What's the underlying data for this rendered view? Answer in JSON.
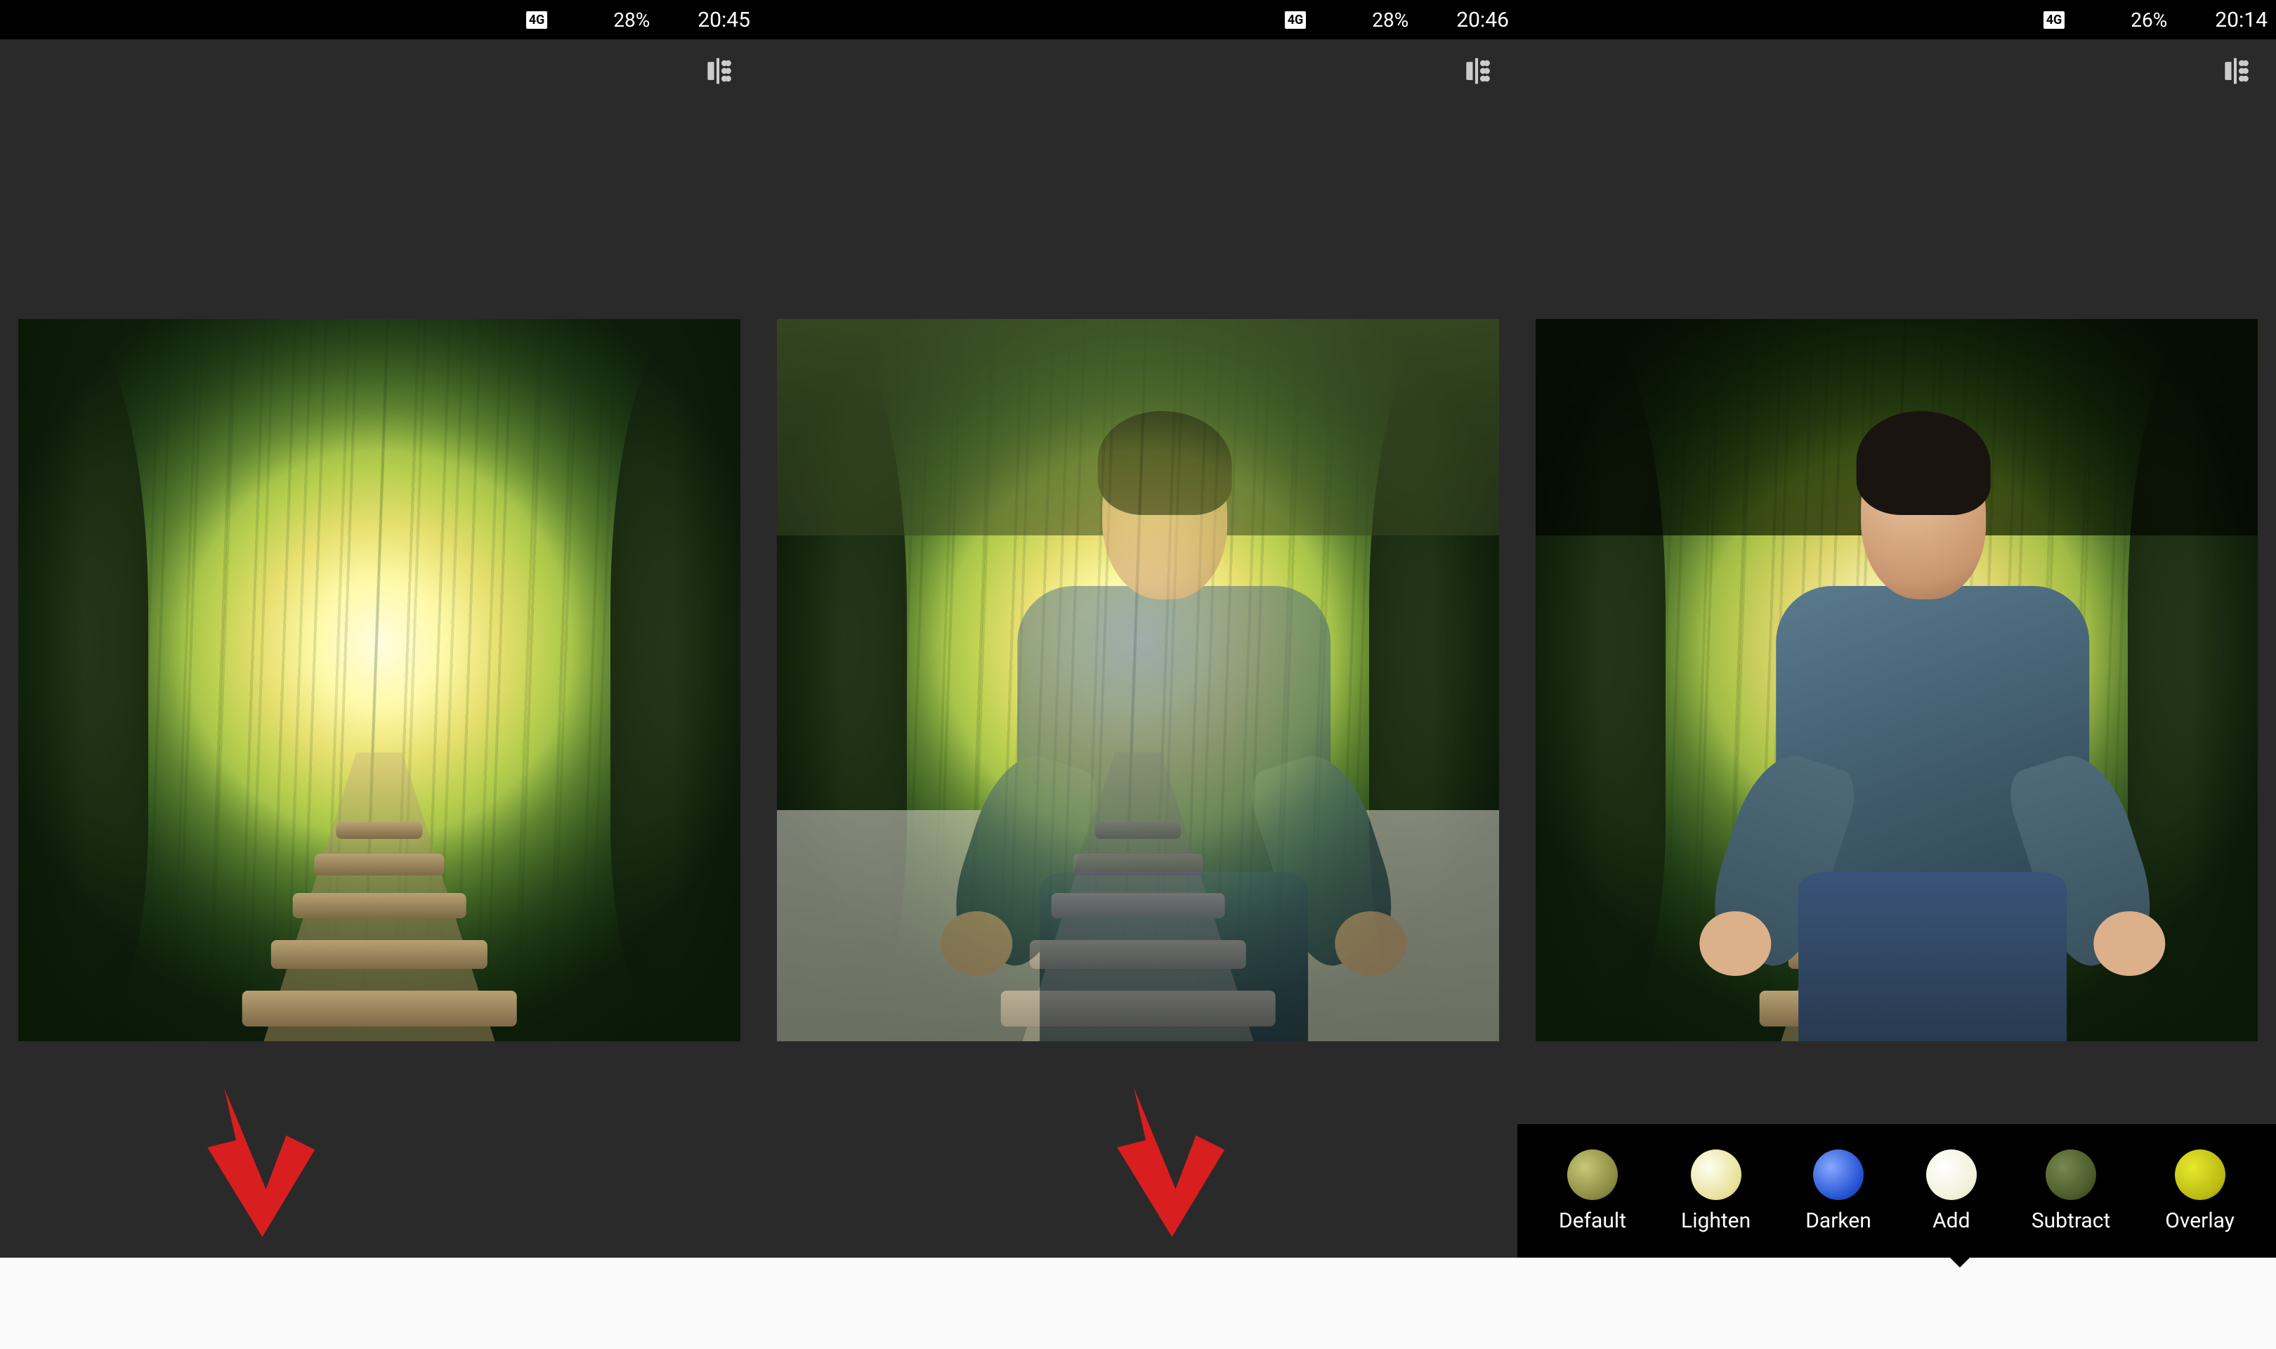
{
  "screens": [
    {
      "status": {
        "network_badge": "4G",
        "battery_percent": "28%",
        "time": "20:45"
      },
      "blend_strip_visible": false,
      "bottom_active_index": null,
      "arrow_target_index": 1
    },
    {
      "status": {
        "network_badge": "4G",
        "battery_percent": "28%",
        "time": "20:46"
      },
      "blend_strip_visible": false,
      "bottom_active_index": null,
      "arrow_target_index": 2
    },
    {
      "status": {
        "network_badge": "4G",
        "battery_percent": "26%",
        "time": "20:14"
      },
      "blend_strip_visible": true,
      "bottom_active_index": 2,
      "arrow_target_index": null
    }
  ],
  "blend_modes": [
    {
      "key": "default",
      "label": "Default"
    },
    {
      "key": "lighten",
      "label": "Lighten"
    },
    {
      "key": "darken",
      "label": "Darken"
    },
    {
      "key": "add",
      "label": "Add"
    },
    {
      "key": "subtract",
      "label": "Subtract"
    },
    {
      "key": "overlay",
      "label": "Overlay"
    }
  ],
  "bottom_icons": [
    {
      "name": "cancel-icon"
    },
    {
      "name": "add-image-icon"
    },
    {
      "name": "style-swatches-icon"
    },
    {
      "name": "opacity-icon"
    },
    {
      "name": "confirm-icon"
    }
  ],
  "status_icons_left": [
    "facebook-icon",
    "facebook-icon",
    "whatsapp-icon",
    "hotspot-icon",
    "picture-icon"
  ],
  "status_icons_right": [
    "hotspot-icon",
    "alarm-icon"
  ],
  "blend_pointer_under_index": 3
}
